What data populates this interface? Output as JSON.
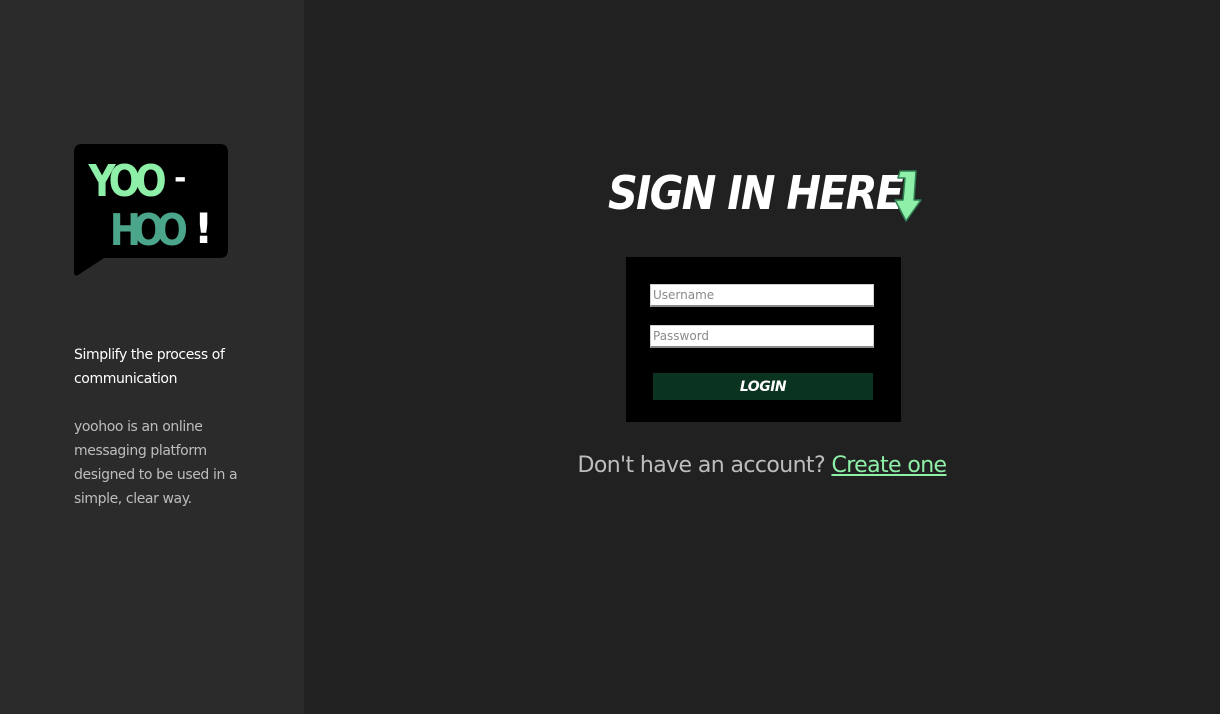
{
  "brand": {
    "logo_line1": "YOO",
    "logo_dash": "-",
    "logo_line2": "HOO",
    "logo_exclaim": "!",
    "logo_light_green": "#8ef0a8",
    "logo_teal": "#4aa58a"
  },
  "sidebar": {
    "tagline": "Simplify the process of communication",
    "description": "yoohoo is an online messaging platform designed to be used in a simple, clear way."
  },
  "main": {
    "heading": "SIGN IN HERE",
    "heading_icon": "arrow-down-icon",
    "form": {
      "username_placeholder": "Username",
      "username_value": "",
      "password_placeholder": "Password",
      "password_value": "",
      "login_label": "LOGIN"
    },
    "signup_prompt": "Don't have an account?",
    "signup_link": "Create one"
  },
  "colors": {
    "sidebar_bg": "#2b2b2b",
    "main_bg": "#212121",
    "accent": "#8ef0a8",
    "button_bg": "#0a3320"
  }
}
